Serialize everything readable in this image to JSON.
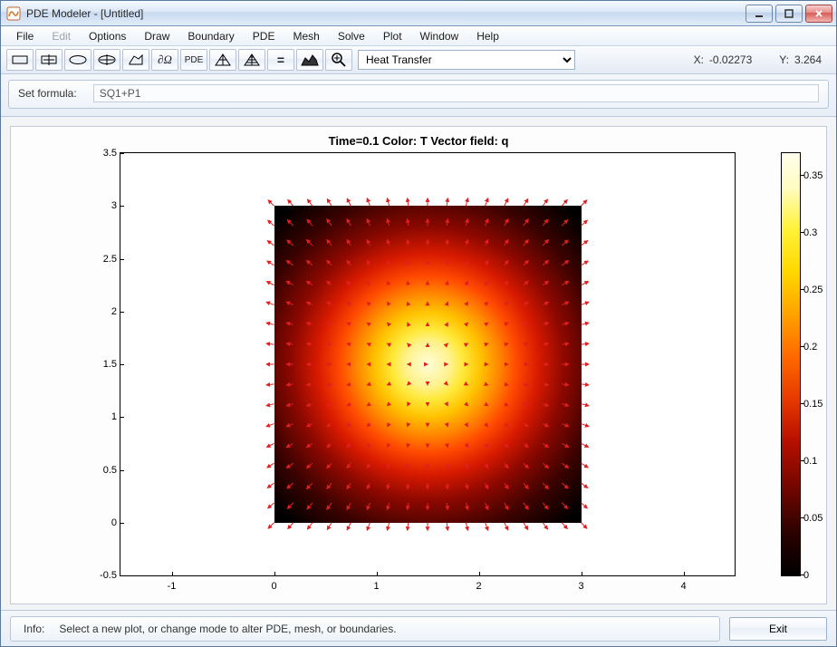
{
  "window": {
    "title": "PDE Modeler - [Untitled]"
  },
  "menu": {
    "items": [
      "File",
      "Edit",
      "Options",
      "Draw",
      "Boundary",
      "PDE",
      "Mesh",
      "Solve",
      "Plot",
      "Window",
      "Help"
    ],
    "disabled_index": 1
  },
  "toolbar": {
    "icons": [
      "rect",
      "rect-center",
      "ellipse",
      "ellipse-center",
      "polygon",
      "domega",
      "pde",
      "mesh",
      "mesh-refine",
      "equals",
      "solve",
      "zoom"
    ],
    "application_selected": "Heat Transfer"
  },
  "coords": {
    "x_label": "X:",
    "x": "-0.02273",
    "y_label": "Y:",
    "y": "3.264"
  },
  "formula": {
    "label": "Set formula:",
    "value": "SQ1+P1"
  },
  "chart_data": {
    "type": "heatmap",
    "title": "Time=0.1   Color: T  Vector field: q",
    "xlim": [
      -1.5,
      4.5
    ],
    "ylim": [
      -0.5,
      3.5
    ],
    "xticks": [
      -1,
      0,
      1,
      2,
      3,
      4
    ],
    "yticks": [
      -0.5,
      0,
      0.5,
      1,
      1.5,
      2,
      2.5,
      3,
      3.5
    ],
    "colorbar": {
      "min": 0,
      "max": 0.37,
      "ticks": [
        0,
        0.05,
        0.1,
        0.15,
        0.2,
        0.25,
        0.3,
        0.35
      ]
    },
    "heat_extent": {
      "x0": 0,
      "x1": 3,
      "y0": 0,
      "y1": 3
    },
    "center": [
      1.5,
      1.5
    ],
    "vector_grid": {
      "nx": 17,
      "ny": 17
    }
  },
  "info": {
    "label": "Info:",
    "message": "Select a new plot, or change mode to alter PDE, mesh, or boundaries."
  },
  "exit": {
    "label": "Exit"
  }
}
